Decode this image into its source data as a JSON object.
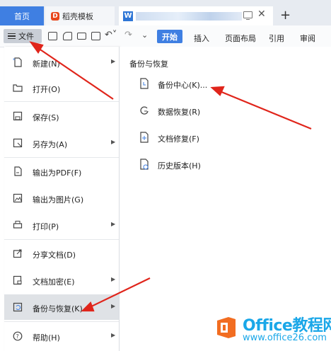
{
  "tabs": {
    "home": "首页",
    "template": "稻壳模板",
    "doc_title": ""
  },
  "toolbar": {
    "file_label": "文件",
    "ribbon_tabs": [
      "开始",
      "插入",
      "页面布局",
      "引用",
      "审阅"
    ]
  },
  "menu": {
    "items": [
      {
        "label": "新建(N)",
        "icon": "new-file-icon",
        "has_submenu": true
      },
      {
        "label": "打开(O)",
        "icon": "folder-icon",
        "has_submenu": false
      },
      {
        "label": "保存(S)",
        "icon": "save-icon",
        "has_submenu": false
      },
      {
        "label": "另存为(A)",
        "icon": "save-as-icon",
        "has_submenu": true
      },
      {
        "label": "输出为PDF(F)",
        "icon": "pdf-icon",
        "has_submenu": false
      },
      {
        "label": "输出为图片(G)",
        "icon": "image-icon",
        "has_submenu": false
      },
      {
        "label": "打印(P)",
        "icon": "print-icon",
        "has_submenu": true
      },
      {
        "label": "分享文档(D)",
        "icon": "share-icon",
        "has_submenu": false
      },
      {
        "label": "文档加密(E)",
        "icon": "lock-icon",
        "has_submenu": true
      },
      {
        "label": "备份与恢复(K)",
        "icon": "backup-icon",
        "has_submenu": true,
        "active": true
      },
      {
        "label": "帮助(H)",
        "icon": "help-icon",
        "has_submenu": true
      }
    ]
  },
  "submenu": {
    "title": "备份与恢复",
    "items": [
      {
        "label": "备份中心(K)...",
        "icon": "backup-center-icon"
      },
      {
        "label": "数据恢复(R)",
        "icon": "data-recovery-icon"
      },
      {
        "label": "文档修复(F)",
        "icon": "document-repair-icon"
      },
      {
        "label": "历史版本(H)",
        "icon": "history-version-icon"
      }
    ]
  },
  "watermark": {
    "title": "Office教程网",
    "url": "www.office26.com"
  },
  "colors": {
    "accent_blue": "#3f7fe2",
    "arrow_red": "#e0251b",
    "watermark_orange": "#f26d21",
    "watermark_blue": "#1aa7e8"
  }
}
